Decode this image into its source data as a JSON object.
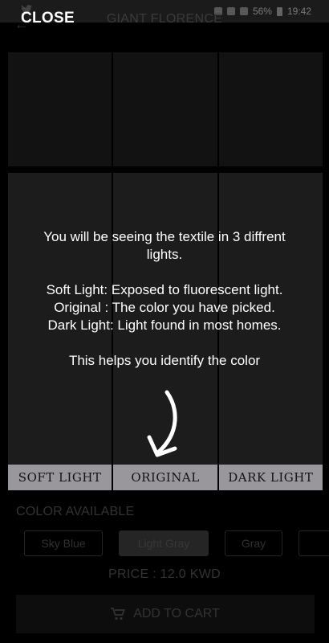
{
  "app": {
    "title": "GIANT FLORENCE",
    "status": {
      "battery": "56%",
      "time": "19:42"
    }
  },
  "textile_views": [
    {
      "label": "SOFT LIGHT"
    },
    {
      "label": "ORIGINAL"
    },
    {
      "label": "DARK LIGHT"
    }
  ],
  "colors": {
    "heading": "COLOR AVAILABLE",
    "options": [
      "Sky Blue",
      "Light Gray",
      "Gray"
    ],
    "selected": "Light Gray"
  },
  "price": "PRICE : 12.0 KWD",
  "add_to_cart": "ADD TO CART",
  "overlay": {
    "close": "CLOSE",
    "line1": "You will be seeing the textile in 3 diffrent",
    "line2": "lights.",
    "line3": "Soft Light: Exposed to fluorescent light.",
    "line4": "Original : The color you have picked.",
    "line5": "Dark Light: Light found in most homes.",
    "line6": "This helps you identify the color",
    "arrow_icon": "curved-down-arrow-icon"
  }
}
